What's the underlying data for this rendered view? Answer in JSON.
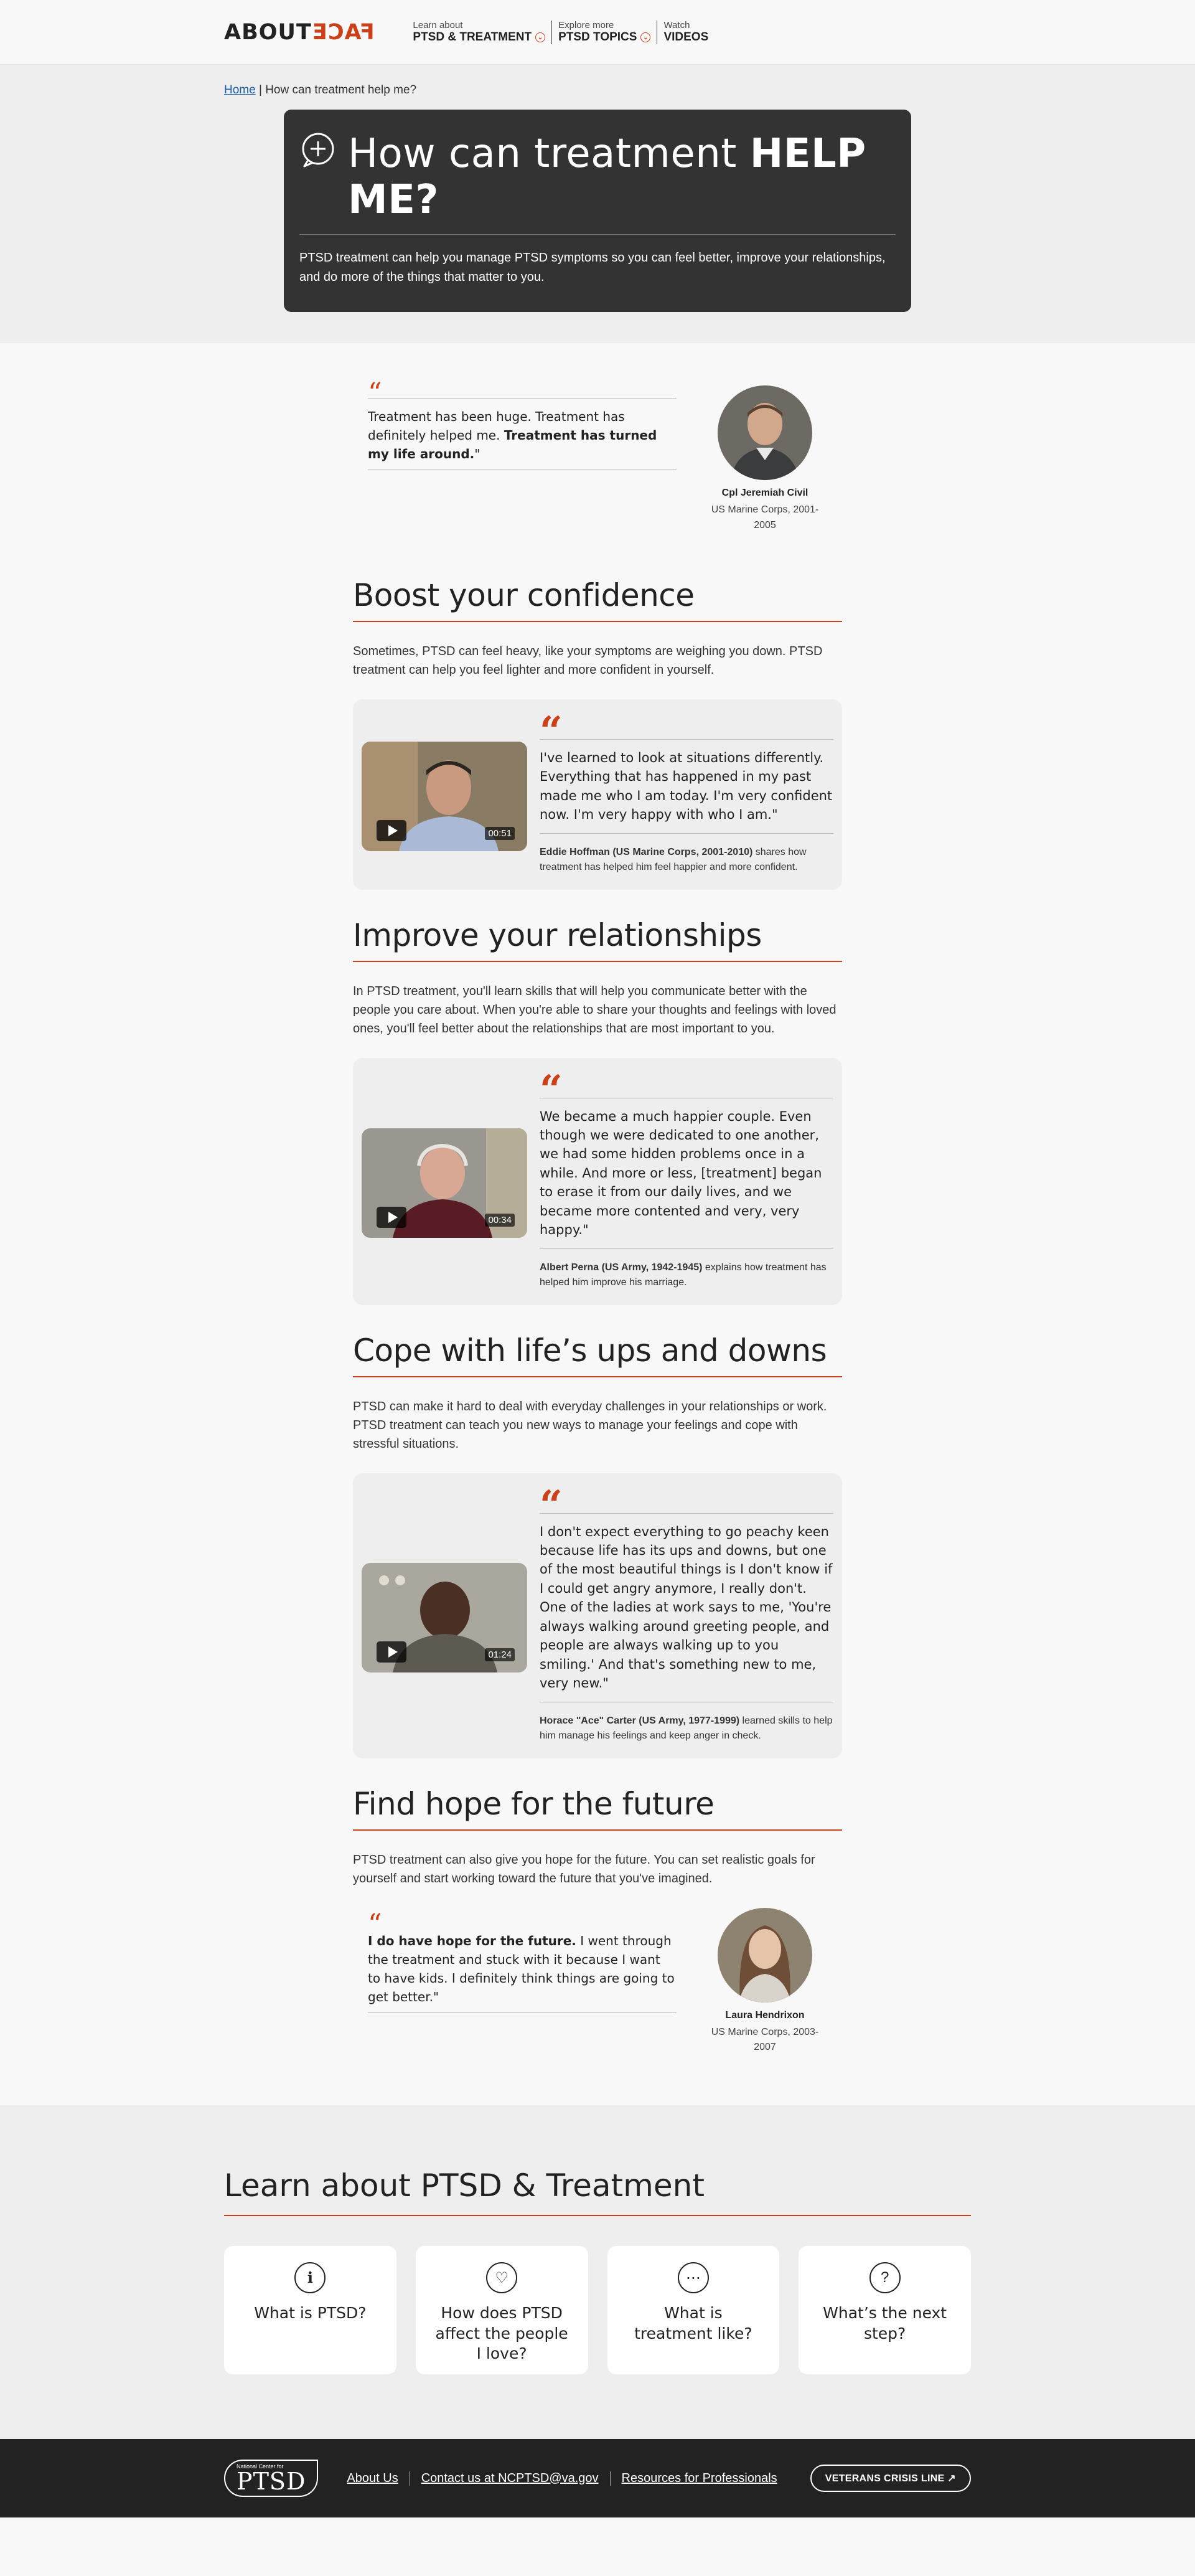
{
  "header": {
    "logo_about": "ABOUT",
    "logo_face": "FACE",
    "nav": [
      {
        "sub": "Learn about",
        "main": "PTSD & TREATMENT",
        "has_menu": true
      },
      {
        "sub": "Explore more",
        "main": "PTSD TOPICS",
        "has_menu": true
      },
      {
        "sub": "Watch",
        "main": "VIDEOS",
        "has_menu": false
      }
    ]
  },
  "breadcrumb": {
    "home": "Home",
    "separator": "|",
    "current": "How can treatment help me?"
  },
  "hero": {
    "title_light": "How can treatment ",
    "title_bold": "HELP ME?",
    "text": "PTSD treatment can help you manage PTSD symptoms so you can feel better, improve your relationships, and do more of the things that matter to you."
  },
  "quote1": {
    "text_plain": "Treatment has been huge. Treatment has definitely helped me. ",
    "text_bold": "Treatment has turned my life around.",
    "text_end": "\"",
    "name": "Cpl Jeremiah Civil",
    "desc": "US Marine Corps, 2001-2005"
  },
  "sections": [
    {
      "heading": "Boost your confidence",
      "text": "Sometimes, PTSD can feel heavy, like your symptoms are weighing you down. PTSD treatment can help you feel lighter and more confident in yourself.",
      "video": {
        "duration": "00:51",
        "quote": "I've learned to look at situations differently. Everything that has happened in my past made me who I am today. I'm very confident now. I'm very happy with who I am.\"",
        "speaker": "Eddie Hoffman (US Marine Corps, 2001-2010)",
        "caption": " shares how treatment has helped him feel happier and more confident."
      }
    },
    {
      "heading": "Improve your relationships",
      "text": "In PTSD treatment, you'll learn skills that will help you communicate better with the people you care about. When you're able to share your thoughts and feelings with loved ones, you'll feel better about the relationships that are most important to you.",
      "video": {
        "duration": "00:34",
        "quote": "We became a much happier couple. Even though we were dedicated to one another, we had some hidden problems once in a while. And more or less, [treatment] began to erase it from our daily lives, and we became more contented and very, very happy.\"",
        "speaker": "Albert Perna (US Army, 1942-1945)",
        "caption": " explains how treatment has helped him improve his marriage."
      }
    },
    {
      "heading": "Cope with life’s ups and downs",
      "text": "PTSD can make it hard to deal with everyday challenges in your relationships or work. PTSD treatment can teach you new ways to manage your feelings and cope with stressful situations.",
      "video": {
        "duration": "01:24",
        "quote": "I don't expect everything to go peachy keen because life has its ups and downs, but one of the most beautiful things is I don't know if I could get angry anymore, I really don't. One of the ladies at work says to me, 'You're always walking around greeting people, and people are always walking up to you smiling.' And that's something new to me, very new.\"",
        "speaker": "Horace \"Ace\" Carter (US Army, 1977-1999)",
        "caption": " learned skills to help him manage his feelings and keep anger in check."
      }
    }
  ],
  "section4": {
    "heading": "Find hope for the future",
    "text": "PTSD treatment can also give you hope for the future. You can set realistic goals for yourself and start working toward the future that you've imagined."
  },
  "quote2": {
    "text_bold": "I do have hope for the future.",
    "text_plain": " I went through the treatment and stuck with it because I want to have kids. I definitely think things are going to get better.\"",
    "name": "Laura Hendrixon",
    "desc": "US Marine Corps, 2003-2007"
  },
  "learn": {
    "heading": "Learn about PTSD & Treatment",
    "cards": [
      {
        "label": "What is PTSD?",
        "icon": "info-icon"
      },
      {
        "label": "How does PTSD affect the people I love?",
        "icon": "heart-icon"
      },
      {
        "label": "What is treatment like?",
        "icon": "chat-icon"
      },
      {
        "label": "What’s the next step?",
        "icon": "question-icon"
      }
    ]
  },
  "footer": {
    "logo_small": "National Center for",
    "logo_big": "PTSD",
    "links": [
      "About Us",
      "Contact us at NCPTSD@va.gov",
      "Resources for Professionals"
    ],
    "crisis": "VETERANS CRISIS LINE"
  },
  "colors": {
    "accent": "#c8411a",
    "hero_bg": "#333333",
    "section_bg": "#eeeeee",
    "footer_bg": "#222222"
  }
}
